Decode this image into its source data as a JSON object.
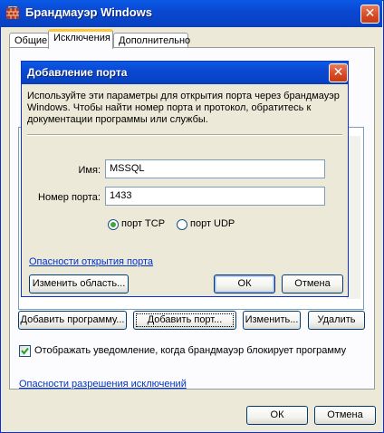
{
  "window": {
    "title": "Брандмауэр Windows",
    "close_glyph": "✕"
  },
  "tabs": [
    {
      "label": "Общие"
    },
    {
      "label": "Исключения"
    },
    {
      "label": "Дополнительно"
    }
  ],
  "dialog": {
    "title": "Добавление порта",
    "close_glyph": "✕",
    "description": "Используйте эти параметры для открытия порта через брандмауэр Windows. Чтобы найти номер порта и протокол, обратитесь к документации программы или службы.",
    "name_label": "Имя:",
    "name_value": "MSSQL",
    "port_label": "Номер порта:",
    "port_value": "1433",
    "tcp_label": "порт TCP",
    "udp_label": "порт UDP",
    "selected_protocol": "TCP",
    "risk_link": "Опасности открытия порта",
    "change_scope_button": "Изменить область...",
    "ok_button": "ОК",
    "cancel_button": "Отмена"
  },
  "exceptions": {
    "add_program_button": "Добавить программу...",
    "add_port_button": "Добавить порт...",
    "edit_button": "Изменить...",
    "delete_button": "Удалить",
    "notify_label": "Отображать уведомление, когда брандмауэр блокирует программу",
    "notify_checked": true,
    "risk_link": "Опасности разрешения исключений"
  },
  "footer": {
    "ok_button": "ОК",
    "cancel_button": "Отмена"
  },
  "colors": {
    "titlebar": "#0a48d2",
    "face": "#ece9d8",
    "link": "#0033cc",
    "close_button": "#d64a24",
    "check_mark": "#21a121"
  }
}
